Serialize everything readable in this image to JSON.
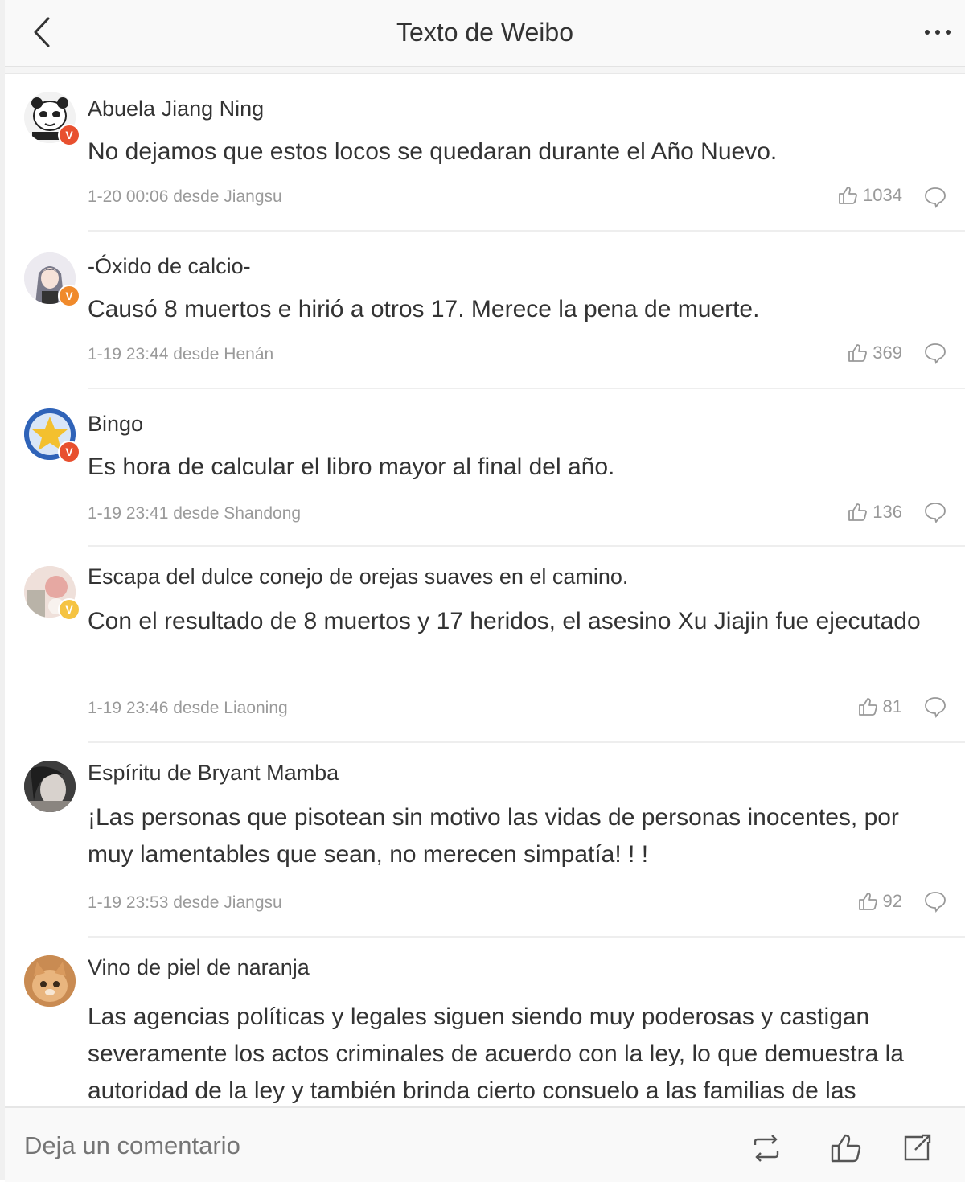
{
  "header": {
    "title": "Texto de Weibo",
    "back_icon": "chevron-left-icon",
    "more_icon": "ellipsis-icon"
  },
  "comments": [
    {
      "username": "Abuela Jiang Ning",
      "text": "No dejamos que estos locos se quedaran durante el Año Nuevo.",
      "meta": "1-20 00:06 desde Jiangsu",
      "likes": "1034",
      "badge": "V",
      "badge_color": "#e8502f"
    },
    {
      "username": "-Óxido de calcio-",
      "text": "Causó 8 muertos e hirió a otros 17. Merece la pena de muerte.",
      "meta": "1-19 23:44 desde Henán",
      "likes": "369",
      "badge": "V",
      "badge_color": "#f08a2b"
    },
    {
      "username": "Bingo",
      "text": "Es hora de calcular el libro mayor al final del año.",
      "meta": "1-19 23:41 desde Shandong",
      "likes": "136",
      "badge": "V",
      "badge_color": "#e8502f"
    },
    {
      "username": "Escapa del dulce conejo de orejas suaves en el camino.",
      "text": "Con el resultado de 8 muertos y 17 heridos, el asesino Xu Jiajin fue ejecutado",
      "meta": "1-19 23:46 desde Liaoning",
      "likes": "81",
      "badge": "V",
      "badge_color": "#f5c342"
    },
    {
      "username": "Espíritu de Bryant Mamba",
      "text": "¡Las personas que pisotean sin motivo las vidas de personas inocentes, por muy lamentables que sean, no merecen simpatía! ! !",
      "meta": "1-19 23:53 desde Jiangsu",
      "likes": "92",
      "badge": "",
      "badge_color": ""
    },
    {
      "username": "Vino de piel de naranja",
      "text": "Las agencias políticas y legales siguen siendo muy poderosas y castigan severamente los actos criminales de acuerdo con la ley, lo que demuestra la autoridad de la ley y también brinda cierto consuelo a las familias de las",
      "meta": "",
      "likes": "",
      "badge": "",
      "badge_color": ""
    }
  ],
  "bottom_bar": {
    "input_placeholder": "Deja un comentario",
    "repost_icon": "repost-icon",
    "like_icon": "thumbs-up-icon",
    "share_icon": "share-icon"
  }
}
